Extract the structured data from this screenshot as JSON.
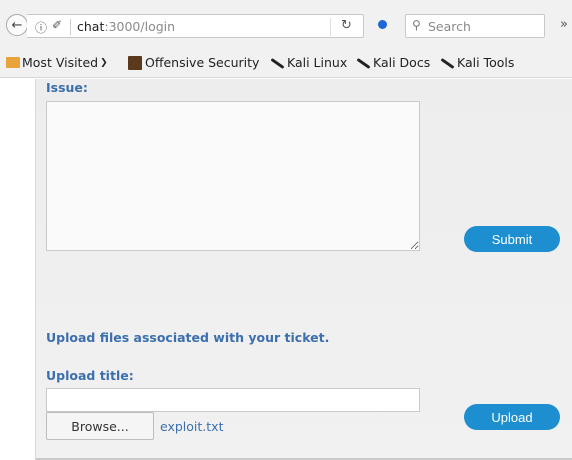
{
  "browser": {
    "url_host": "chat",
    "url_rest": ":3000/login",
    "search_placeholder": "Search",
    "icons": [
      "back-arrow-icon",
      "info-icon",
      "key-icon",
      "reload-icon",
      "pocket-icon",
      "search-icon",
      "overflow-icon"
    ]
  },
  "bookmarks": [
    {
      "label": "Most Visited",
      "icon": "folder-icon"
    },
    {
      "label": "Offensive Security",
      "icon": "offsec-icon"
    },
    {
      "label": "Kali Linux",
      "icon": "kali-dragon-icon"
    },
    {
      "label": "Kali Docs",
      "icon": "kali-dragon-icon"
    },
    {
      "label": "Kali Tools",
      "icon": "kali-dragon-icon"
    }
  ],
  "form": {
    "issue_label": "Issue:",
    "submit_label": "Submit",
    "upload_heading": "Upload files associated with your ticket.",
    "upload_title_label": "Upload title:",
    "browse_label": "Browse...",
    "selected_file": "exploit.txt",
    "upload_label": "Upload"
  },
  "colors": {
    "accent_button": "#1d8fd0",
    "label_blue": "#3c6fae"
  }
}
